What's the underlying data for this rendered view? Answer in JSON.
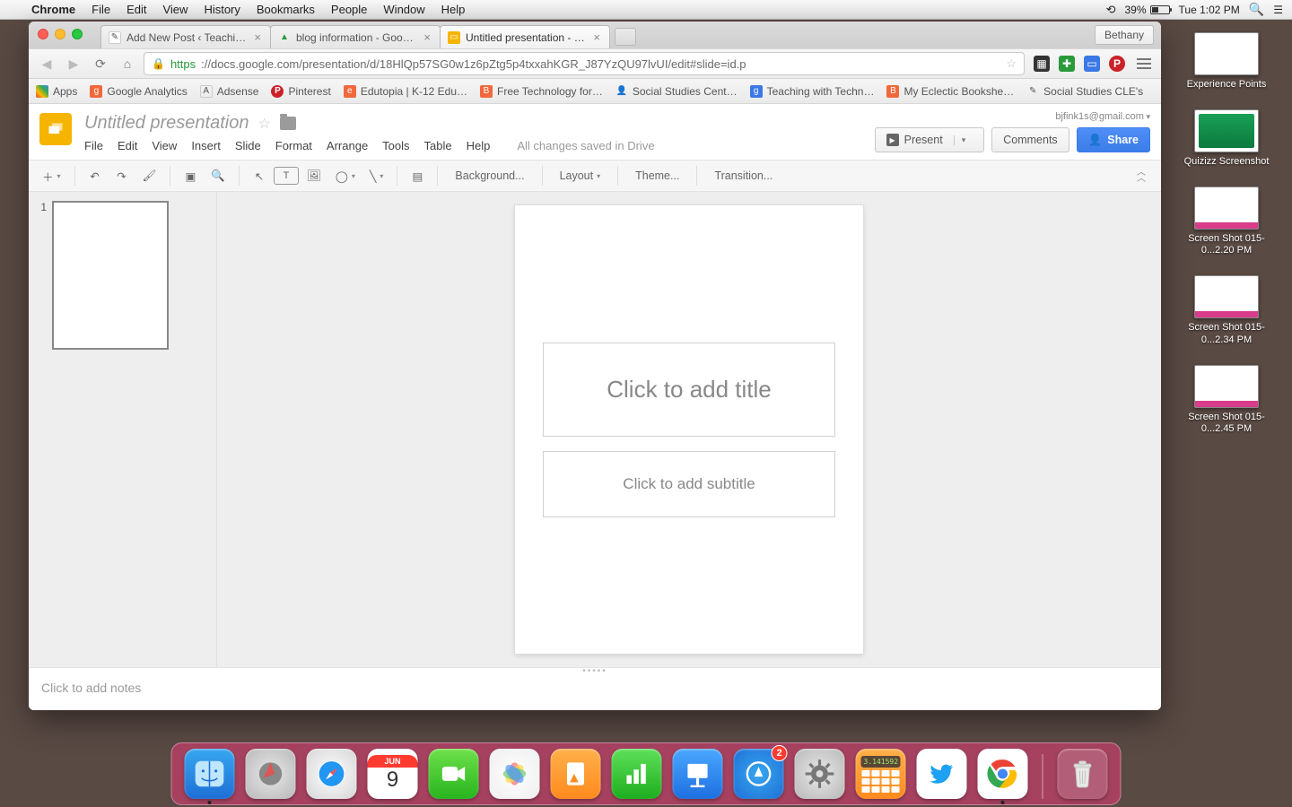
{
  "mac": {
    "app": "Chrome",
    "menus": [
      "File",
      "Edit",
      "View",
      "History",
      "Bookmarks",
      "People",
      "Window",
      "Help"
    ],
    "battery_pct": "39%",
    "clock": "Tue 1:02 PM"
  },
  "desktop": [
    {
      "label": "Experience Points"
    },
    {
      "label": "Quizizz Screenshot"
    },
    {
      "label": "Screen Shot 015-0...2.20 PM"
    },
    {
      "label": "Screen Shot 015-0...2.34 PM"
    },
    {
      "label": "Screen Shot 015-0...2.45 PM"
    }
  ],
  "chrome": {
    "profile": "Bethany",
    "tabs": [
      {
        "title": "Add New Post ‹ Teaching w…",
        "active": false
      },
      {
        "title": "blog information - Google D…",
        "active": false
      },
      {
        "title": "Untitled presentation - Goo…",
        "active": true
      }
    ],
    "url_scheme": "https",
    "url_rest": "://docs.google.com/presentation/d/18HlQp57SG0w1z6pZtg5p4txxahKGR_J87YzQU97lvUI/edit#slide=id.p",
    "bookmarks": [
      {
        "label": "Apps",
        "color": "#777"
      },
      {
        "label": "Google Analytics",
        "color": "#f0683b"
      },
      {
        "label": "Adsense",
        "color": "#3b78e7"
      },
      {
        "label": "Pinterest",
        "color": "#cb2128"
      },
      {
        "label": "Edutopia | K-12 Edu…",
        "color": "#f0683b"
      },
      {
        "label": "Free Technology for…",
        "color": "#f0683b"
      },
      {
        "label": "Social Studies Cent…",
        "color": "#9a9a9a"
      },
      {
        "label": "Teaching with Techn…",
        "color": "#3b78e7"
      },
      {
        "label": "My Eclectic Bookshe…",
        "color": "#f0683b"
      },
      {
        "label": "Social Studies CLE's",
        "color": "#9a9a9a"
      }
    ]
  },
  "slides": {
    "title": "Untitled presentation",
    "menus": [
      "File",
      "Edit",
      "View",
      "Insert",
      "Slide",
      "Format",
      "Arrange",
      "Tools",
      "Table",
      "Help"
    ],
    "saved_msg": "All changes saved in Drive",
    "email": "bjfink1s@gmail.com",
    "btn_present": "Present",
    "btn_comments": "Comments",
    "btn_share": "Share",
    "toolbar": {
      "background": "Background...",
      "layout": "Layout",
      "theme": "Theme...",
      "transition": "Transition..."
    },
    "thumb_num": "1",
    "ph_title": "Click to add title",
    "ph_sub": "Click to add subtitle",
    "notes_hint": "Click to add notes"
  },
  "dock": {
    "appstore_badge": "2",
    "calendar_month": "JUN",
    "calendar_day": "9"
  }
}
